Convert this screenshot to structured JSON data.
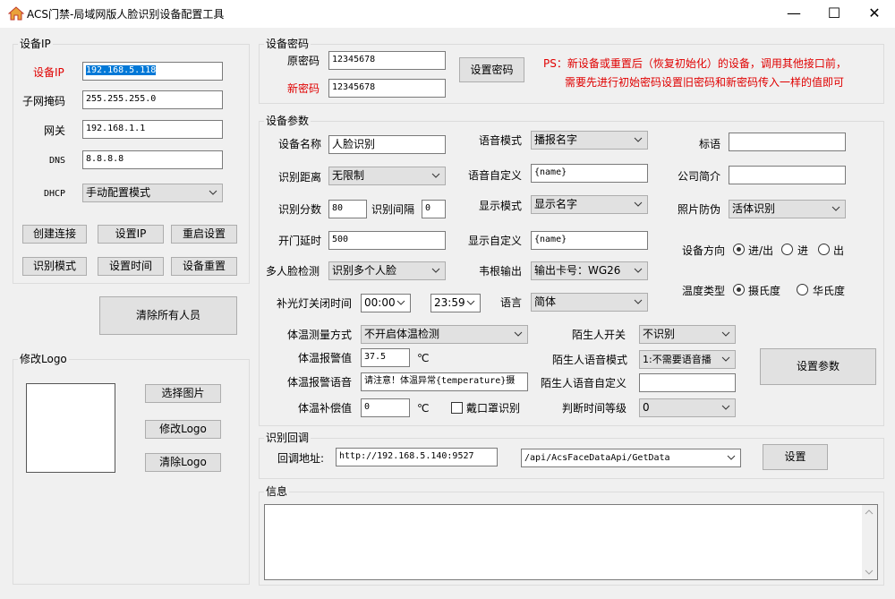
{
  "window": {
    "title": "ACS门禁-局域网版人脸识别设备配置工具",
    "minimize": "—",
    "maximize": "☐",
    "close": "✕"
  },
  "ip_group": {
    "title": "设备IP",
    "device_ip_label": "设备IP",
    "device_ip": "192.168.5.118",
    "subnet_label": "子网掩码",
    "subnet": "255.255.255.0",
    "gateway_label": "网关",
    "gateway": "192.168.1.1",
    "dns_label": "DNS",
    "dns": "8.8.8.8",
    "dhcp_label": "DHCP",
    "dhcp": "手动配置模式",
    "buttons": [
      "创建连接",
      "设置IP",
      "重启设置",
      "识别模式",
      "设置时间",
      "设备重置"
    ],
    "clear_all": "清除所有人员"
  },
  "logo_group": {
    "title": "修改Logo",
    "select_image": "选择图片",
    "modify_logo": "修改Logo",
    "clear_logo": "清除Logo"
  },
  "password_group": {
    "title": "设备密码",
    "old_label": "原密码",
    "old_value": "12345678",
    "new_label": "新密码",
    "new_value": "12345678",
    "set_button": "设置密码",
    "note_line1": "PS：新设备或重置后（恢复初始化）的设备，调用其他接口前，",
    "note_line2": "需要先进行初始密码设置旧密码和新密码传入一样的值即可"
  },
  "params_group": {
    "title": "设备参数",
    "device_name_label": "设备名称",
    "device_name": "人脸识别",
    "distance_label": "识别距离",
    "distance": "无限制",
    "score_label": "识别分数",
    "score": "80",
    "interval_label": "识别间隔",
    "interval": "0",
    "door_delay_label": "开门延时",
    "door_delay": "500",
    "multi_face_label": "多人脸检测",
    "multi_face": "识别多个人脸",
    "fill_light_label": "补光灯关闭时间",
    "fill_light_start": "00:00",
    "fill_light_end": "23:59",
    "voice_mode_label": "语音模式",
    "voice_mode": "播报名字",
    "voice_custom_label": "语音自定义",
    "voice_custom": "{name}",
    "display_mode_label": "显示模式",
    "display_mode": "显示名字",
    "display_custom_label": "显示自定义",
    "display_custom": "{name}",
    "wiegand_label": "韦根输出",
    "wiegand": "输出卡号：WG26",
    "language_label": "语言",
    "language": "简体",
    "slogan_label": "标语",
    "slogan": "",
    "company_label": "公司简介",
    "company": "",
    "anti_photo_label": "照片防伪",
    "anti_photo": "活体识别",
    "direction_label": "设备方向",
    "direction_options": [
      "进/出",
      "进",
      "出"
    ],
    "temp_type_label": "温度类型",
    "temp_type_options": [
      "摄氏度",
      "华氏度"
    ],
    "temp_method_label": "体温测量方式",
    "temp_method": "不开启体温检测",
    "temp_alarm_label": "体温报警值",
    "temp_alarm": "37.5",
    "temp_unit": "℃",
    "temp_alarm_voice_label": "体温报警语音",
    "temp_alarm_voice": "请注意！体温异常{temperature}摄",
    "temp_comp_label": "体温补偿值",
    "temp_comp": "0",
    "temp_comp_unit": "℃",
    "mask_label": "戴口罩识别",
    "stranger_switch_label": "陌生人开关",
    "stranger_switch": "不识别",
    "stranger_voice_mode_label": "陌生人语音模式",
    "stranger_voice_mode": "1:不需要语音播",
    "stranger_voice_custom_label": "陌生人语音自定义",
    "stranger_voice_custom": "",
    "judge_level_label": "判断时间等级",
    "judge_level": "0",
    "set_params": "设置参数"
  },
  "callback_group": {
    "title": "识别回调",
    "url_label": "回调地址:",
    "url": "http://192.168.5.140:9527",
    "path": "/api/AcsFaceDataApi/GetData",
    "set_button": "设置"
  },
  "info_group": {
    "title": "信息",
    "content": ""
  }
}
